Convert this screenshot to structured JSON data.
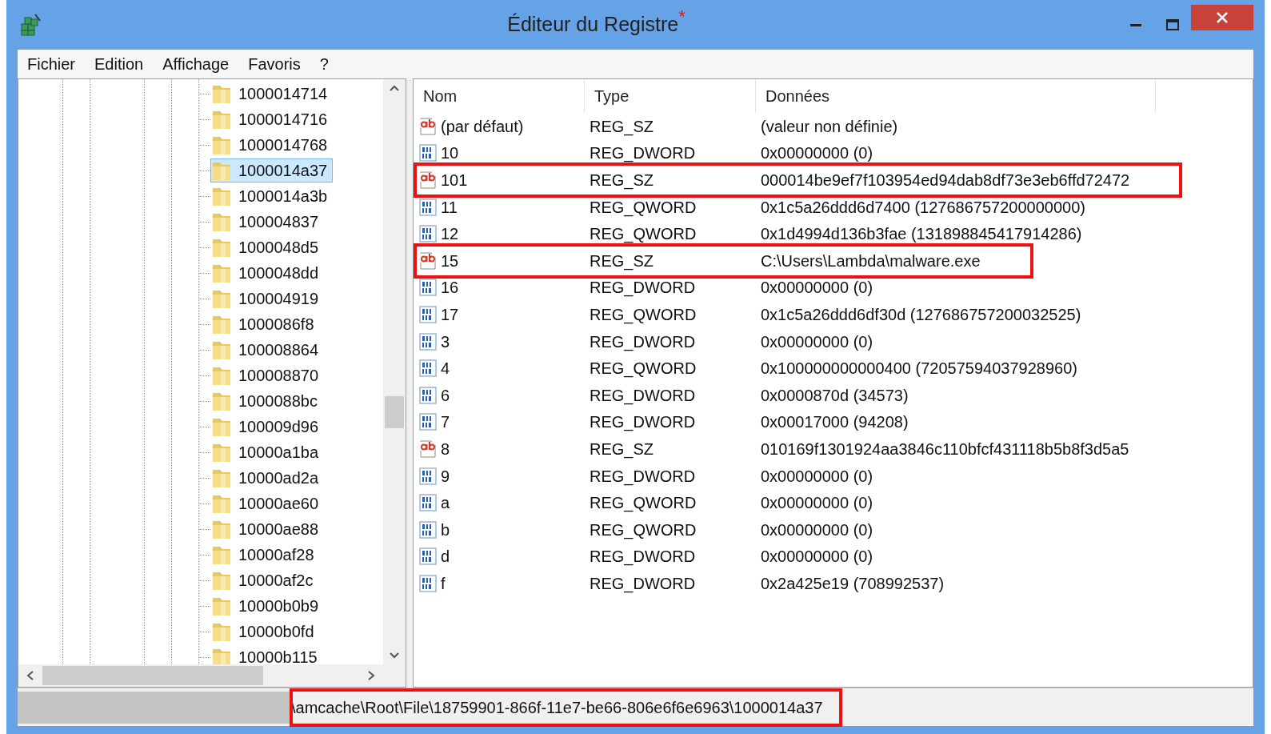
{
  "window": {
    "title": "Éditeur du Registre",
    "modified_mark": "*"
  },
  "menu": [
    "Fichier",
    "Edition",
    "Affichage",
    "Favoris",
    "?"
  ],
  "tree": {
    "items": [
      {
        "label": "1000014714",
        "selected": false
      },
      {
        "label": "1000014716",
        "selected": false
      },
      {
        "label": "1000014768",
        "selected": false
      },
      {
        "label": "1000014a37",
        "selected": true
      },
      {
        "label": "1000014a3b",
        "selected": false
      },
      {
        "label": "100004837",
        "selected": false
      },
      {
        "label": "1000048d5",
        "selected": false
      },
      {
        "label": "1000048dd",
        "selected": false
      },
      {
        "label": "100004919",
        "selected": false
      },
      {
        "label": "1000086f8",
        "selected": false
      },
      {
        "label": "100008864",
        "selected": false
      },
      {
        "label": "100008870",
        "selected": false
      },
      {
        "label": "1000088bc",
        "selected": false
      },
      {
        "label": "100009d96",
        "selected": false
      },
      {
        "label": "10000a1ba",
        "selected": false
      },
      {
        "label": "10000ad2a",
        "selected": false
      },
      {
        "label": "10000ae60",
        "selected": false
      },
      {
        "label": "10000ae88",
        "selected": false
      },
      {
        "label": "10000af28",
        "selected": false
      },
      {
        "label": "10000af2c",
        "selected": false
      },
      {
        "label": "10000b0b9",
        "selected": false
      },
      {
        "label": "10000b0fd",
        "selected": false
      },
      {
        "label": "10000b115",
        "selected": false
      }
    ]
  },
  "values": {
    "columns": [
      "Nom",
      "Type",
      "Données"
    ],
    "rows": [
      {
        "kind": "string",
        "name": "(par défaut)",
        "type": "REG_SZ",
        "data": "(valeur non définie)",
        "highlighted": false
      },
      {
        "kind": "binary",
        "name": "10",
        "type": "REG_DWORD",
        "data": "0x00000000 (0)",
        "highlighted": false
      },
      {
        "kind": "string",
        "name": "101",
        "type": "REG_SZ",
        "data": "000014be9ef7f103954ed94dab8df73e3eb6ffd72472",
        "highlighted": true
      },
      {
        "kind": "binary",
        "name": "11",
        "type": "REG_QWORD",
        "data": "0x1c5a26ddd6d7400 (127686757200000000)",
        "highlighted": false
      },
      {
        "kind": "binary",
        "name": "12",
        "type": "REG_QWORD",
        "data": "0x1d4994d136b3fae (131898845417914286)",
        "highlighted": false
      },
      {
        "kind": "string",
        "name": "15",
        "type": "REG_SZ",
        "data": "C:\\Users\\Lambda\\malware.exe",
        "highlighted": true
      },
      {
        "kind": "binary",
        "name": "16",
        "type": "REG_DWORD",
        "data": "0x00000000 (0)",
        "highlighted": false
      },
      {
        "kind": "binary",
        "name": "17",
        "type": "REG_QWORD",
        "data": "0x1c5a26ddd6df30d (127686757200032525)",
        "highlighted": false
      },
      {
        "kind": "binary",
        "name": "3",
        "type": "REG_DWORD",
        "data": "0x00000000 (0)",
        "highlighted": false
      },
      {
        "kind": "binary",
        "name": "4",
        "type": "REG_QWORD",
        "data": "0x100000000000400 (72057594037928960)",
        "highlighted": false
      },
      {
        "kind": "binary",
        "name": "6",
        "type": "REG_DWORD",
        "data": "0x0000870d (34573)",
        "highlighted": false
      },
      {
        "kind": "binary",
        "name": "7",
        "type": "REG_DWORD",
        "data": "0x00017000 (94208)",
        "highlighted": false
      },
      {
        "kind": "string",
        "name": "8",
        "type": "REG_SZ",
        "data": "010169f1301924aa3846c110bfcf431118b5b8f3d5a5",
        "highlighted": false
      },
      {
        "kind": "binary",
        "name": "9",
        "type": "REG_DWORD",
        "data": "0x00000000 (0)",
        "highlighted": false
      },
      {
        "kind": "binary",
        "name": "a",
        "type": "REG_QWORD",
        "data": "0x00000000 (0)",
        "highlighted": false
      },
      {
        "kind": "binary",
        "name": "b",
        "type": "REG_QWORD",
        "data": "0x00000000 (0)",
        "highlighted": false
      },
      {
        "kind": "binary",
        "name": "d",
        "type": "REG_DWORD",
        "data": "0x00000000 (0)",
        "highlighted": false
      },
      {
        "kind": "binary",
        "name": "f",
        "type": "REG_DWORD",
        "data": "0x2a425e19 (708992537)",
        "highlighted": false
      }
    ]
  },
  "status_bar": {
    "path": "\\amcache\\Root\\File\\18759901-866f-11e7-be66-806e6f6e6963\\1000014a37",
    "redacted": true,
    "highlighted": true
  }
}
